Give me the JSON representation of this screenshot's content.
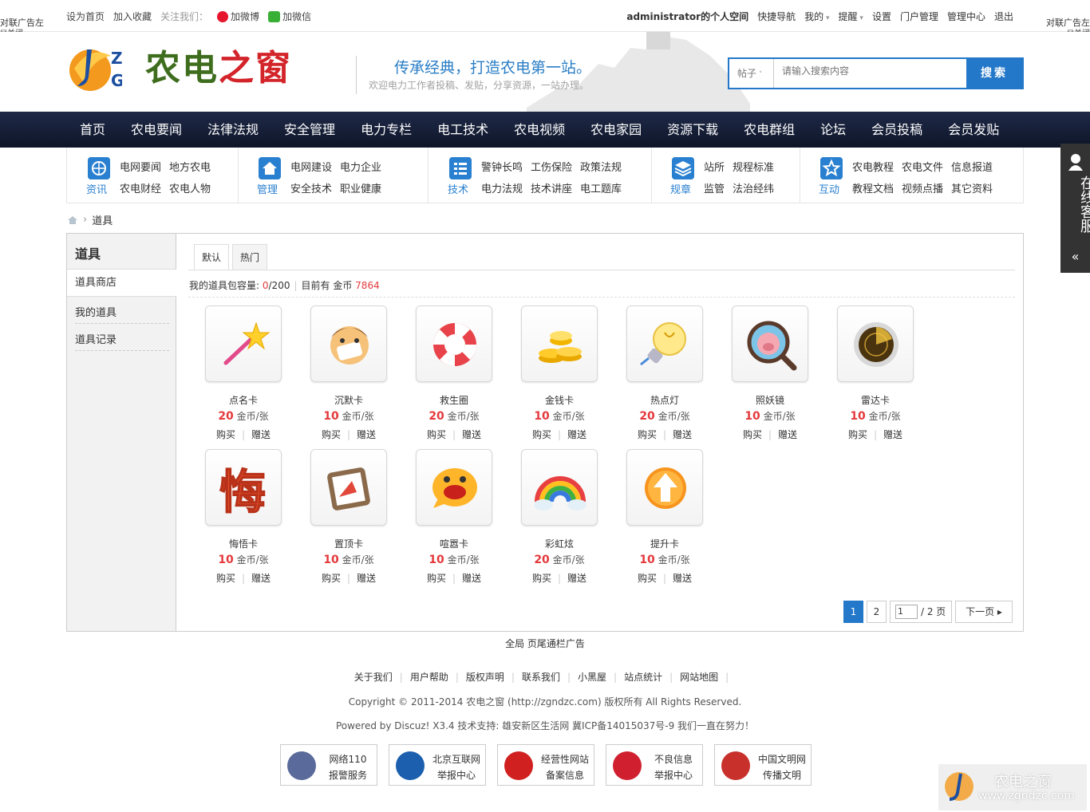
{
  "topbar": {
    "left_links": [
      "设为首页",
      "加入收藏"
    ],
    "follow_label": "关注我们：",
    "weibo": "加微博",
    "weixin": "加微信",
    "user_space": "administrator的个人空间",
    "right_links": [
      "快捷导航",
      "我的",
      "提醒",
      "设置",
      "门户管理",
      "管理中心",
      "退出"
    ]
  },
  "couplet": {
    "left_label": "对联广告左",
    "left_close": "☒关闭",
    "right_label": "对联广告左",
    "right_close": "☒关闭"
  },
  "header": {
    "logo_text_1": "农电",
    "logo_text_2": "之窗",
    "logo_letters": "ZG",
    "slogan": "传承经典，打造农电第一站。",
    "welcome": "欢迎电力工作者投稿、发贴，分享资源，一站办理。",
    "search_type": "帖子",
    "search_placeholder": "请输入搜索内容",
    "search_button": "搜索"
  },
  "nav": [
    "首页",
    "农电要闻",
    "法律法规",
    "安全管理",
    "电力专栏",
    "电工技术",
    "农电视频",
    "农电家园",
    "资源下载",
    "农电群组",
    "论坛",
    "会员投稿",
    "会员发贴"
  ],
  "subnav": [
    {
      "caption": "资讯",
      "icon": "globe-icon",
      "links": [
        "电网要闻",
        "地方农电",
        "农电财经",
        "农电人物"
      ]
    },
    {
      "caption": "管理",
      "icon": "home-icon",
      "links": [
        "电网建设",
        "电力企业",
        "安全技术",
        "职业健康"
      ]
    },
    {
      "caption": "技术",
      "icon": "list-icon",
      "links": [
        "警钟长鸣",
        "工伤保险",
        "政策法规",
        "电力法规",
        "技术讲座",
        "电工题库"
      ]
    },
    {
      "caption": "规章",
      "icon": "layers-icon",
      "links": [
        "站所",
        "规程标准",
        "监管",
        "法治经纬"
      ]
    },
    {
      "caption": "互动",
      "icon": "star-icon",
      "links": [
        "农电教程",
        "农电文件",
        "信息报道",
        "教程文档",
        "视频点播",
        "其它资料"
      ]
    }
  ],
  "breadcrumb": {
    "current": "道具"
  },
  "sidebar": {
    "title": "道具",
    "items": [
      "道具商店",
      "我的道具",
      "道具记录"
    ]
  },
  "tabs": [
    "默认",
    "热门"
  ],
  "capacity": {
    "label": "我的道具包容量:",
    "used": "0",
    "total": "/200",
    "gold_label": "目前有 金币",
    "gold": "7864"
  },
  "props": [
    {
      "name": "点名卡",
      "price": "20",
      "unit": "金币/张",
      "icon": "magic-wand-icon"
    },
    {
      "name": "沉默卡",
      "price": "10",
      "unit": "金币/张",
      "icon": "silence-face-icon"
    },
    {
      "name": "救生圈",
      "price": "20",
      "unit": "金币/张",
      "icon": "lifebuoy-icon"
    },
    {
      "name": "金钱卡",
      "price": "10",
      "unit": "金币/张",
      "icon": "gold-coins-icon"
    },
    {
      "name": "热点灯",
      "price": "20",
      "unit": "金币/张",
      "icon": "light-bulb-icon"
    },
    {
      "name": "照妖镜",
      "price": "10",
      "unit": "金币/张",
      "icon": "magnifier-pig-icon"
    },
    {
      "name": "雷达卡",
      "price": "10",
      "unit": "金币/张",
      "icon": "radar-icon"
    },
    {
      "name": "悔悟卡",
      "price": "10",
      "unit": "金币/张",
      "icon": "regret-char-icon"
    },
    {
      "name": "置顶卡",
      "price": "10",
      "unit": "金币/张",
      "icon": "pin-top-icon"
    },
    {
      "name": "喧嚣卡",
      "price": "10",
      "unit": "金币/张",
      "icon": "shouting-face-icon"
    },
    {
      "name": "彩虹炫",
      "price": "20",
      "unit": "金币/张",
      "icon": "rainbow-icon"
    },
    {
      "name": "提升卡",
      "price": "10",
      "unit": "金币/张",
      "icon": "up-arrow-icon"
    }
  ],
  "prop_actions": {
    "buy": "购买",
    "gift": "赠送"
  },
  "pager": {
    "current": "1",
    "page2": "2",
    "input": "1",
    "total": "/ 2 页",
    "next": "下一页"
  },
  "footer": {
    "ad": "全局 页尾通栏广告",
    "links": [
      "关于我们",
      "用户帮助",
      "版权声明",
      "联系我们",
      "小黑屋",
      "站点统计",
      "网站地图"
    ],
    "copyright": "Copyright © 2011-2014 农电之窗 (http://zgndzc.com) 版权所有 All Rights Reserved.",
    "powered": "Powered by Discuz! X3.4 技术支持: 雄安新区生活网 冀ICP备14015037号-9 我们一直在努力！",
    "badges": [
      {
        "l1": "网络110",
        "l2": "报警服务",
        "color": "#5a6a9a"
      },
      {
        "l1": "北京互联网",
        "l2": "举报中心",
        "color": "#1b5fae"
      },
      {
        "l1": "经营性网站",
        "l2": "备案信息",
        "color": "#d02020"
      },
      {
        "l1": "不良信息",
        "l2": "举报中心",
        "color": "#d02030"
      },
      {
        "l1": "中国文明网",
        "l2": "传播文明",
        "color": "#c8302c"
      }
    ]
  },
  "service": {
    "label": "在线客服"
  },
  "watermark": {
    "t1": "农电之窗",
    "t2": "www.zgndzc.com"
  }
}
